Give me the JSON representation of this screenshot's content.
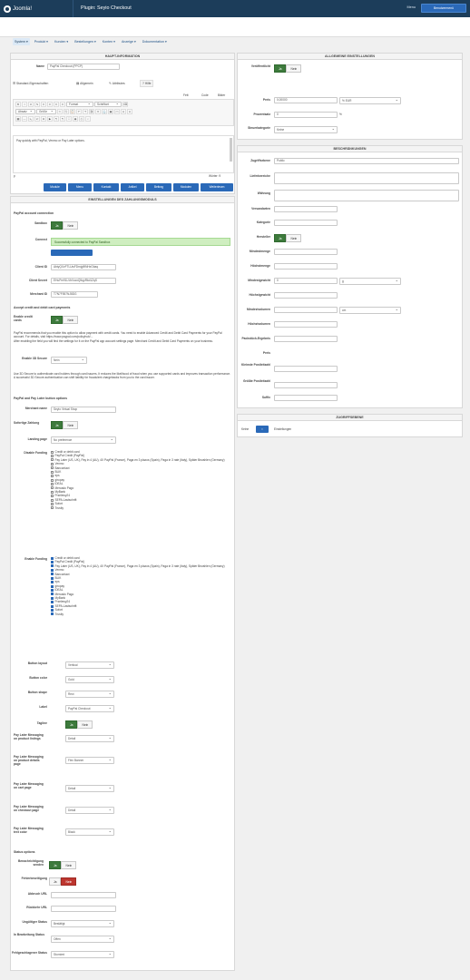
{
  "header": {
    "logo": "Joomla!",
    "page_title": "Plugin: Seyio Checkout",
    "menu": "Menu",
    "user_button": "Benutzermenü"
  },
  "tabs": [
    {
      "label": "System ▾"
    },
    {
      "label": "Produkt ▾"
    },
    {
      "label": "Kunden ▾"
    },
    {
      "label": "Bestellungen ▾"
    },
    {
      "label": "Konten ▾"
    },
    {
      "label": "Anzeige ▾"
    },
    {
      "label": "Dokumentation ▾"
    }
  ],
  "left": {
    "main_header": "Haupt-Information",
    "name_label": "Name",
    "name_value": "PayPal Checkout (PPCP)",
    "subtabs": [
      "Standard-Eigenschaften",
      "Allgemein",
      "Attributes",
      "Hilfe"
    ],
    "editor_tabs": [
      "Fett",
      "Code",
      "Bilder"
    ],
    "format_select": "Format",
    "font_select": "Schriftart",
    "size_select": "Größe",
    "paragraph": "Absatz",
    "editor_text": "Pay quickly with PayPal, Venmo or Pay Later options.",
    "word_count": "Wörter: 9",
    "path": "p",
    "editor_buttons": [
      "Module",
      "Menu",
      "Kontakt",
      "Artikel",
      "Beitrag",
      "Modulen",
      "Weiterlesen"
    ],
    "config_header": "Einstellungen des Zahlungsmoduls",
    "connection_section": "PayPal account connection",
    "sandbox_label": "Sandbox",
    "connect_label": "Connect",
    "connect_status": "Successfully connected to PayPal Sandbox",
    "client_id_label": "Client ID",
    "client_id_value": "AbtyQXvFTLUwFDrnjg9fNHxGbaq",
    "client_secret_label": "Client Secret",
    "client_secret_value": "EHuPm91LVbVucxQ5qpRkd1ZqS",
    "merchant_id_label": "Merchant ID",
    "merchant_id_value": "T7N7F557NJ8DG",
    "card_section": "Accept credit and debit card payments",
    "card_payments_label": "Enable credit cards",
    "card_note": "PayPal recommends that you enable this option to allow payment with credit cards. You need to enable Advanced Credit and Debit Card Payments for your PayPal account. For details, visit https://www.paypal.com/policyhub/...",
    "card_note2": "After enabling the field you will find the settings for it on the PayPal app account settings page. Merchant Credit and Debit Card Payments on your business.",
    "threeds_label": "Enable 3D Secure",
    "threeds_value": "Nein",
    "threeds_note": "Use 3D Secure to authenticate card holders through card issuers. It reduces the likelihood of fraud when you use supported cards and improves transaction performance. A successful 3D Secure authentication can shift liability for fraudulent chargebacks from you to the card issuer.",
    "buttons_section": "PayPal and Pay Later button options",
    "merchant_name_label": "Merchant name",
    "merchant_name_value": "Seyio Virtual Shop",
    "smart_buttons_label": "Sofortige Zahlung",
    "landing_page_label": "Landing page",
    "landing_page_value": "No preference",
    "disable_funding_label": "Disable Funding",
    "funding_options": [
      "Credit or debit card",
      "PayPal Credit (PayPal)",
      "Pay Later (US, UK), Pay in 4 (AU), 4X PayPal (France), Paga en 3 plazos (Spain), Paga in 3 rate (Italy), Später Bezahlen (Germany)",
      "Venmo",
      "Bancontact",
      "BLIK",
      "eps",
      "giropay",
      "iDEAL",
      "Mercado Pago",
      "MyBank",
      "Przelewy24",
      "SEPA-Lastschrift",
      "Sofort",
      "Trustly"
    ],
    "enable_funding_label": "Enable Funding",
    "button_layout_label": "Button layout",
    "button_layout_value": "Vertical",
    "button_color_label": "Button color",
    "button_color_value": "Gold",
    "button_shape_label": "Button shape",
    "button_shape_value": "Rect",
    "label_label": "Label",
    "label_value": "PayPal Checkout",
    "tagline_label": "Tagline",
    "pay_later_product_label": "Pay Later Messaging on product listings",
    "pay_later_product_value": "Detail",
    "pay_later_detail_label": "Pay Later Messaging on product details page",
    "pay_later_detail_value": "Flex Banner",
    "pay_later_cart_label": "Pay Later Messaging on cart page",
    "pay_later_cart_value": "Detail",
    "pay_later_checkout_label": "Pay Later Messaging on checkout page",
    "pay_later_checkout_value": "Detail",
    "pay_later_color_label": "Pay Later Messaging text color",
    "pay_later_color_value": "Black",
    "status_section": "Status options",
    "email_label": "Benachrichtigung senden",
    "debug_label": "Fehlerbeseitigung",
    "return_url_label": "Abbruch URL",
    "cancel_url_label": "Rückkehr URL",
    "success_status_label": "Ungültiger Status",
    "success_status_value": "Bestätigt",
    "pending_status_label": "In Bearbeitung Status",
    "pending_status_value": "Offen",
    "failed_status_label": "Fehlgeschlagener Status",
    "failed_status_value": "Storniert",
    "yes": "Ja",
    "no": "Nein"
  },
  "right": {
    "settings_header": "Allgemeine Einstellungen",
    "published_label": "Veröffentlicht",
    "price_label": "Preis",
    "price_value": "0,00000",
    "price_type_value": "% EUR",
    "percent_label": "Prozentsatz",
    "percent_value": "0",
    "percent_unit": "%",
    "tax_label": "Steuerkategorie",
    "tax_value": "Keine",
    "desc_header": "Beschränkungen",
    "access_label": "Zugriffsebene",
    "access_value": "Public",
    "delivery_label": "Lieferbereiche",
    "currency_label": "Währung",
    "shipping_label": "Versandarten",
    "category_label": "Kategorie",
    "manufacturer_label": "Hersteller",
    "min_qty_label": "Mindestmenge",
    "max_qty_label": "Höchstmenge",
    "weight_label": "Mindestgewicht",
    "weight_value": "0",
    "weight_unit": "g",
    "max_weight_label": "Höchstgewicht",
    "min_vol_label": "Mindestvolumen",
    "min_vol_value": "",
    "vol_unit": "cm",
    "max_vol_label": "Höchstvolumen",
    "size_label": "Packstück-Ergebnis",
    "zip_label": "Preis",
    "from_zip_label": "Kleinste Postleitzahl",
    "to_zip_label": "Größte Postleitzahl",
    "suffix_label": "Suffix",
    "access_header": "Zugriffsebene",
    "access_all": "Keine",
    "access_options": "Einstellungen"
  }
}
